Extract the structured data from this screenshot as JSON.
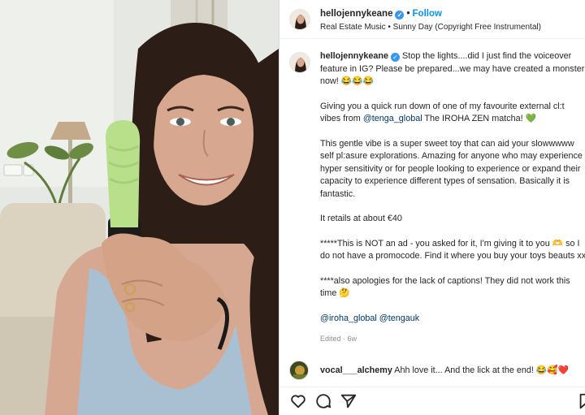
{
  "post": {
    "username": "hellojennykeane",
    "follow_label": "Follow",
    "separator": "•",
    "audio": "Real Estate Music • Sunny Day (Copyright Free Instrumental)"
  },
  "caption": {
    "username": "hellojennykeane",
    "p1": "Stop the lights....did I just find the voiceover feature in IG? Please be prepared...we may have created a monster now! 😂😂😂",
    "p2_before": "Giving you a quick run down of one of my favourite external cl:t vibes from ",
    "p2_mention": "@tenga_global",
    "p2_after": " The IROHA ZEN matcha! 💚",
    "p3": "This gentle vibe is a super sweet toy that can aid your slowwwww self pl:asure explorations. Amazing for anyone who may experience hyper sensitivity or for people looking to experience or expand their capacity to experience different types of sensation. Basically it is fantastic.",
    "p4": "It retails at about €40",
    "p5": "*****This is NOT an ad - you asked for it, I'm giving it to you 🫶 so I do not have a promocode. Find it where you buy your toys beauts xx",
    "p6": "****also apologies for the lack of captions! They did not work this time 🤔",
    "mention_1": "@iroha_global",
    "mention_2": "@tengauk",
    "edited": "Edited · 6w"
  },
  "comment": {
    "username": "vocal___alchemy",
    "text": "Ahh love it... And the lick at the end! 😂🥰❤️"
  },
  "icons": {
    "like": "heart-icon",
    "comment": "comment-icon",
    "share": "paper-plane-icon",
    "save": "bookmark-icon",
    "verified": "verified-badge-icon"
  },
  "colors": {
    "link": "#0095f6",
    "mention": "#00376b",
    "verified": "#3897f0",
    "toy": "#b8df8a"
  }
}
